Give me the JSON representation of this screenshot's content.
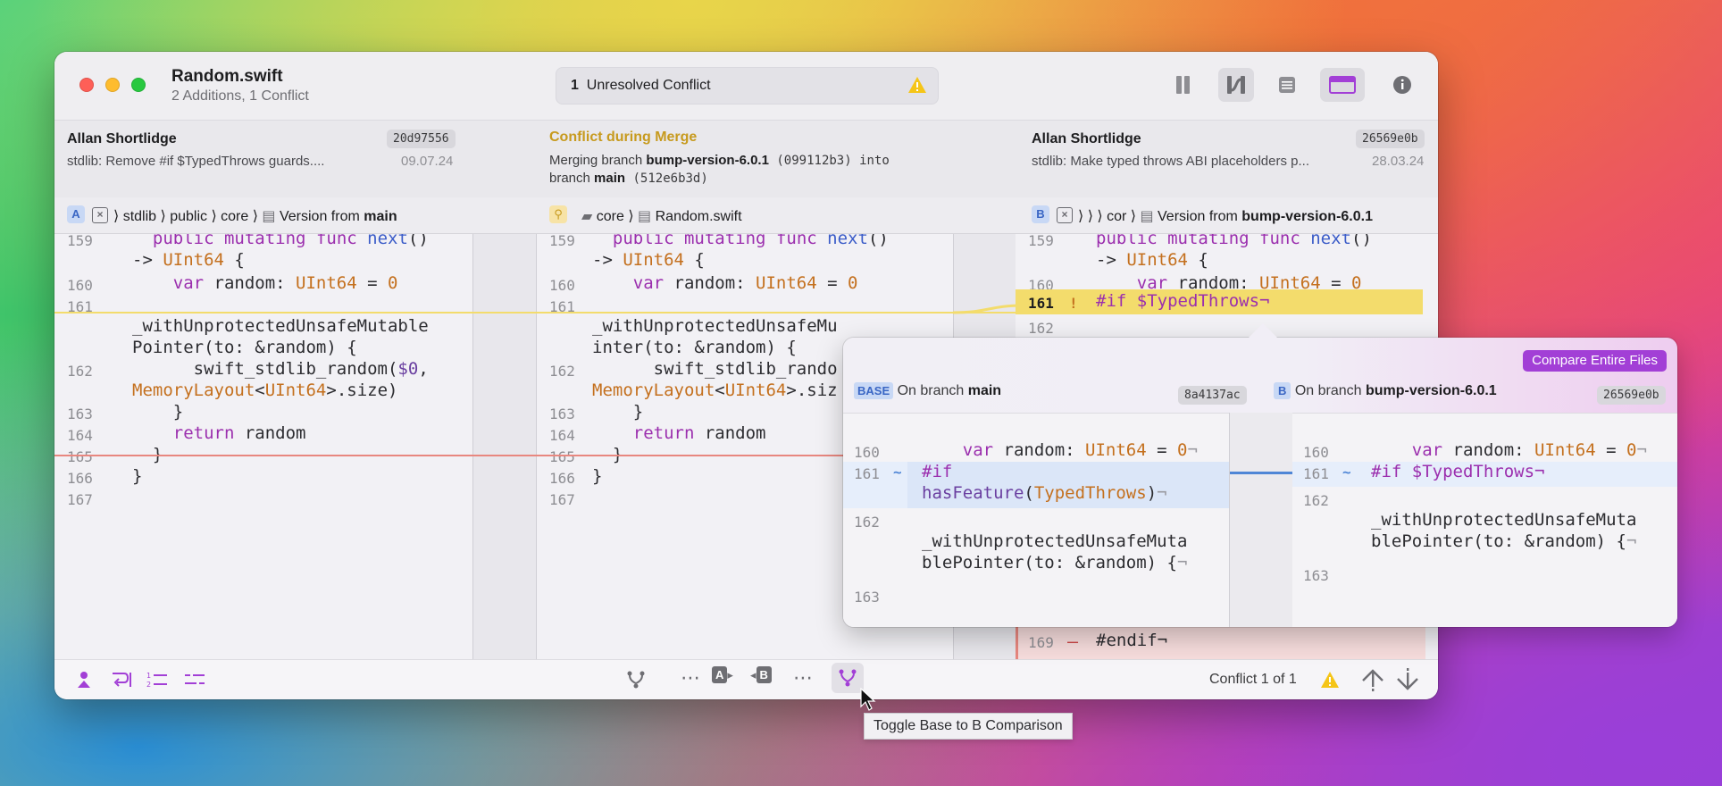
{
  "window": {
    "file_title": "Random.swift",
    "file_subtitle": "2 Additions, 1 Conflict",
    "conflict_count": "1",
    "conflict_label": "Unresolved Conflict"
  },
  "commit_a": {
    "author": "Allan Shortlidge",
    "hash": "20d97556",
    "message": "stdlib: Remove #if $TypedThrows guards....",
    "date": "09.07.24"
  },
  "merge": {
    "title": "Conflict during Merge",
    "line1_prefix": "Merging branch ",
    "branch": "bump-version-6.0.1",
    "branch_hash": " (099112b3) into",
    "line2_prefix": "branch ",
    "target": "main",
    "target_hash": " (512e6b3d)"
  },
  "commit_b": {
    "author": "Allan Shortlidge",
    "hash": "26569e0b",
    "message": "stdlib: Make typed throws ABI placeholders p...",
    "date": "28.03.24"
  },
  "path_a": {
    "badge": "A",
    "crumbs": [
      "stdlib",
      "public",
      "core"
    ],
    "version_prefix": "Version from ",
    "version_branch": "main"
  },
  "path_base": {
    "crumbs": [
      "core",
      "Random.swift"
    ]
  },
  "path_b": {
    "badge": "B",
    "crumbs": [
      "cor"
    ],
    "version_prefix": "Version from ",
    "version_branch": "bump-version-6.0.1"
  },
  "pane_left": {
    "lines": [
      {
        "n": "159",
        "t1": "  public mutating func next()"
      },
      {
        "n": "",
        "t1": "-> UInt64 {"
      },
      {
        "n": "160",
        "t1": "    var random: UInt64 = 0"
      },
      {
        "n": "161",
        "t1": ""
      },
      {
        "n": "",
        "t1": "_withUnprotectedUnsafeMutable"
      },
      {
        "n": "",
        "t1": "Pointer(to: &random) {"
      },
      {
        "n": "162",
        "t1": "      swift_stdlib_random($0,"
      },
      {
        "n": "",
        "t1": "MemoryLayout<UInt64>.size)"
      },
      {
        "n": "163",
        "t1": "    }"
      },
      {
        "n": "164",
        "t1": "    return random"
      },
      {
        "n": "165",
        "t1": "  }"
      },
      {
        "n": "166",
        "t1": "}"
      },
      {
        "n": "167",
        "t1": ""
      }
    ]
  },
  "pane_mid": {
    "lines": [
      {
        "n": "159",
        "t1": "  public mutating func next()"
      },
      {
        "n": "",
        "t1": "-> UInt64 {"
      },
      {
        "n": "160",
        "t1": "    var random: UInt64 = 0"
      },
      {
        "n": "161",
        "t1": ""
      },
      {
        "n": "",
        "t1": "_withUnprotectedUnsafeMu"
      },
      {
        "n": "",
        "t1": "inter(to: &random) {"
      },
      {
        "n": "162",
        "t1": "      swift_stdlib_rando"
      },
      {
        "n": "",
        "t1": "MemoryLayout<UInt64>.siz"
      },
      {
        "n": "163",
        "t1": "    }"
      },
      {
        "n": "164",
        "t1": "    return random"
      },
      {
        "n": "165",
        "t1": "  }"
      },
      {
        "n": "166",
        "t1": "}"
      },
      {
        "n": "167",
        "t1": ""
      }
    ]
  },
  "pane_right": {
    "line159": "159",
    "code159": "  public mutating func next()",
    "code159b": "-> UInt64 {",
    "line160": "160",
    "code160": "    var random: UInt64 = 0",
    "line161": "161",
    "marker161": "!",
    "code161": "#if $TypedThrows¬",
    "line162": "162",
    "line169": "169",
    "marker169": "–",
    "code169": "#endif¬"
  },
  "popover": {
    "compare_button": "Compare Entire Files",
    "base_badge": "BASE",
    "base_label_prefix": "On branch ",
    "base_branch": "main",
    "base_hash": "8a4137ac",
    "b_badge": "B",
    "b_label_prefix": "On branch ",
    "b_branch": "bump-version-6.0.1",
    "b_hash": "26569e0b",
    "left": {
      "n160": "160",
      "c160": "    var random: UInt64 = 0¬",
      "n161": "161",
      "m161": "~",
      "c161a": "#if",
      "c161b": "hasFeature(TypedThrows)¬",
      "n162": "162",
      "c162a": "_withUnprotectedUnsafeMuta",
      "c162b": "blePointer(to: &random) {¬",
      "n163": "163"
    },
    "right": {
      "n160": "160",
      "c160": "    var random: UInt64 = 0¬",
      "n161": "161",
      "m161": "~",
      "c161": "#if $TypedThrows¬",
      "n162": "162",
      "c162a": "_withUnprotectedUnsafeMuta",
      "c162b": "blePointer(to: &random) {¬",
      "n163": "163"
    }
  },
  "bottombar": {
    "status": "Conflict 1 of 1",
    "dots1": "⋯",
    "dots2": "⋯",
    "a_label": "A",
    "b_label": "B"
  },
  "tooltip": "Toggle Base to B Comparison",
  "colors": {
    "accent": "#a23fd6",
    "warning": "#f5c518",
    "conflict_line": "#f3dc6c",
    "removed_line": "#e8877f",
    "link_blue": "#4f86d6"
  }
}
